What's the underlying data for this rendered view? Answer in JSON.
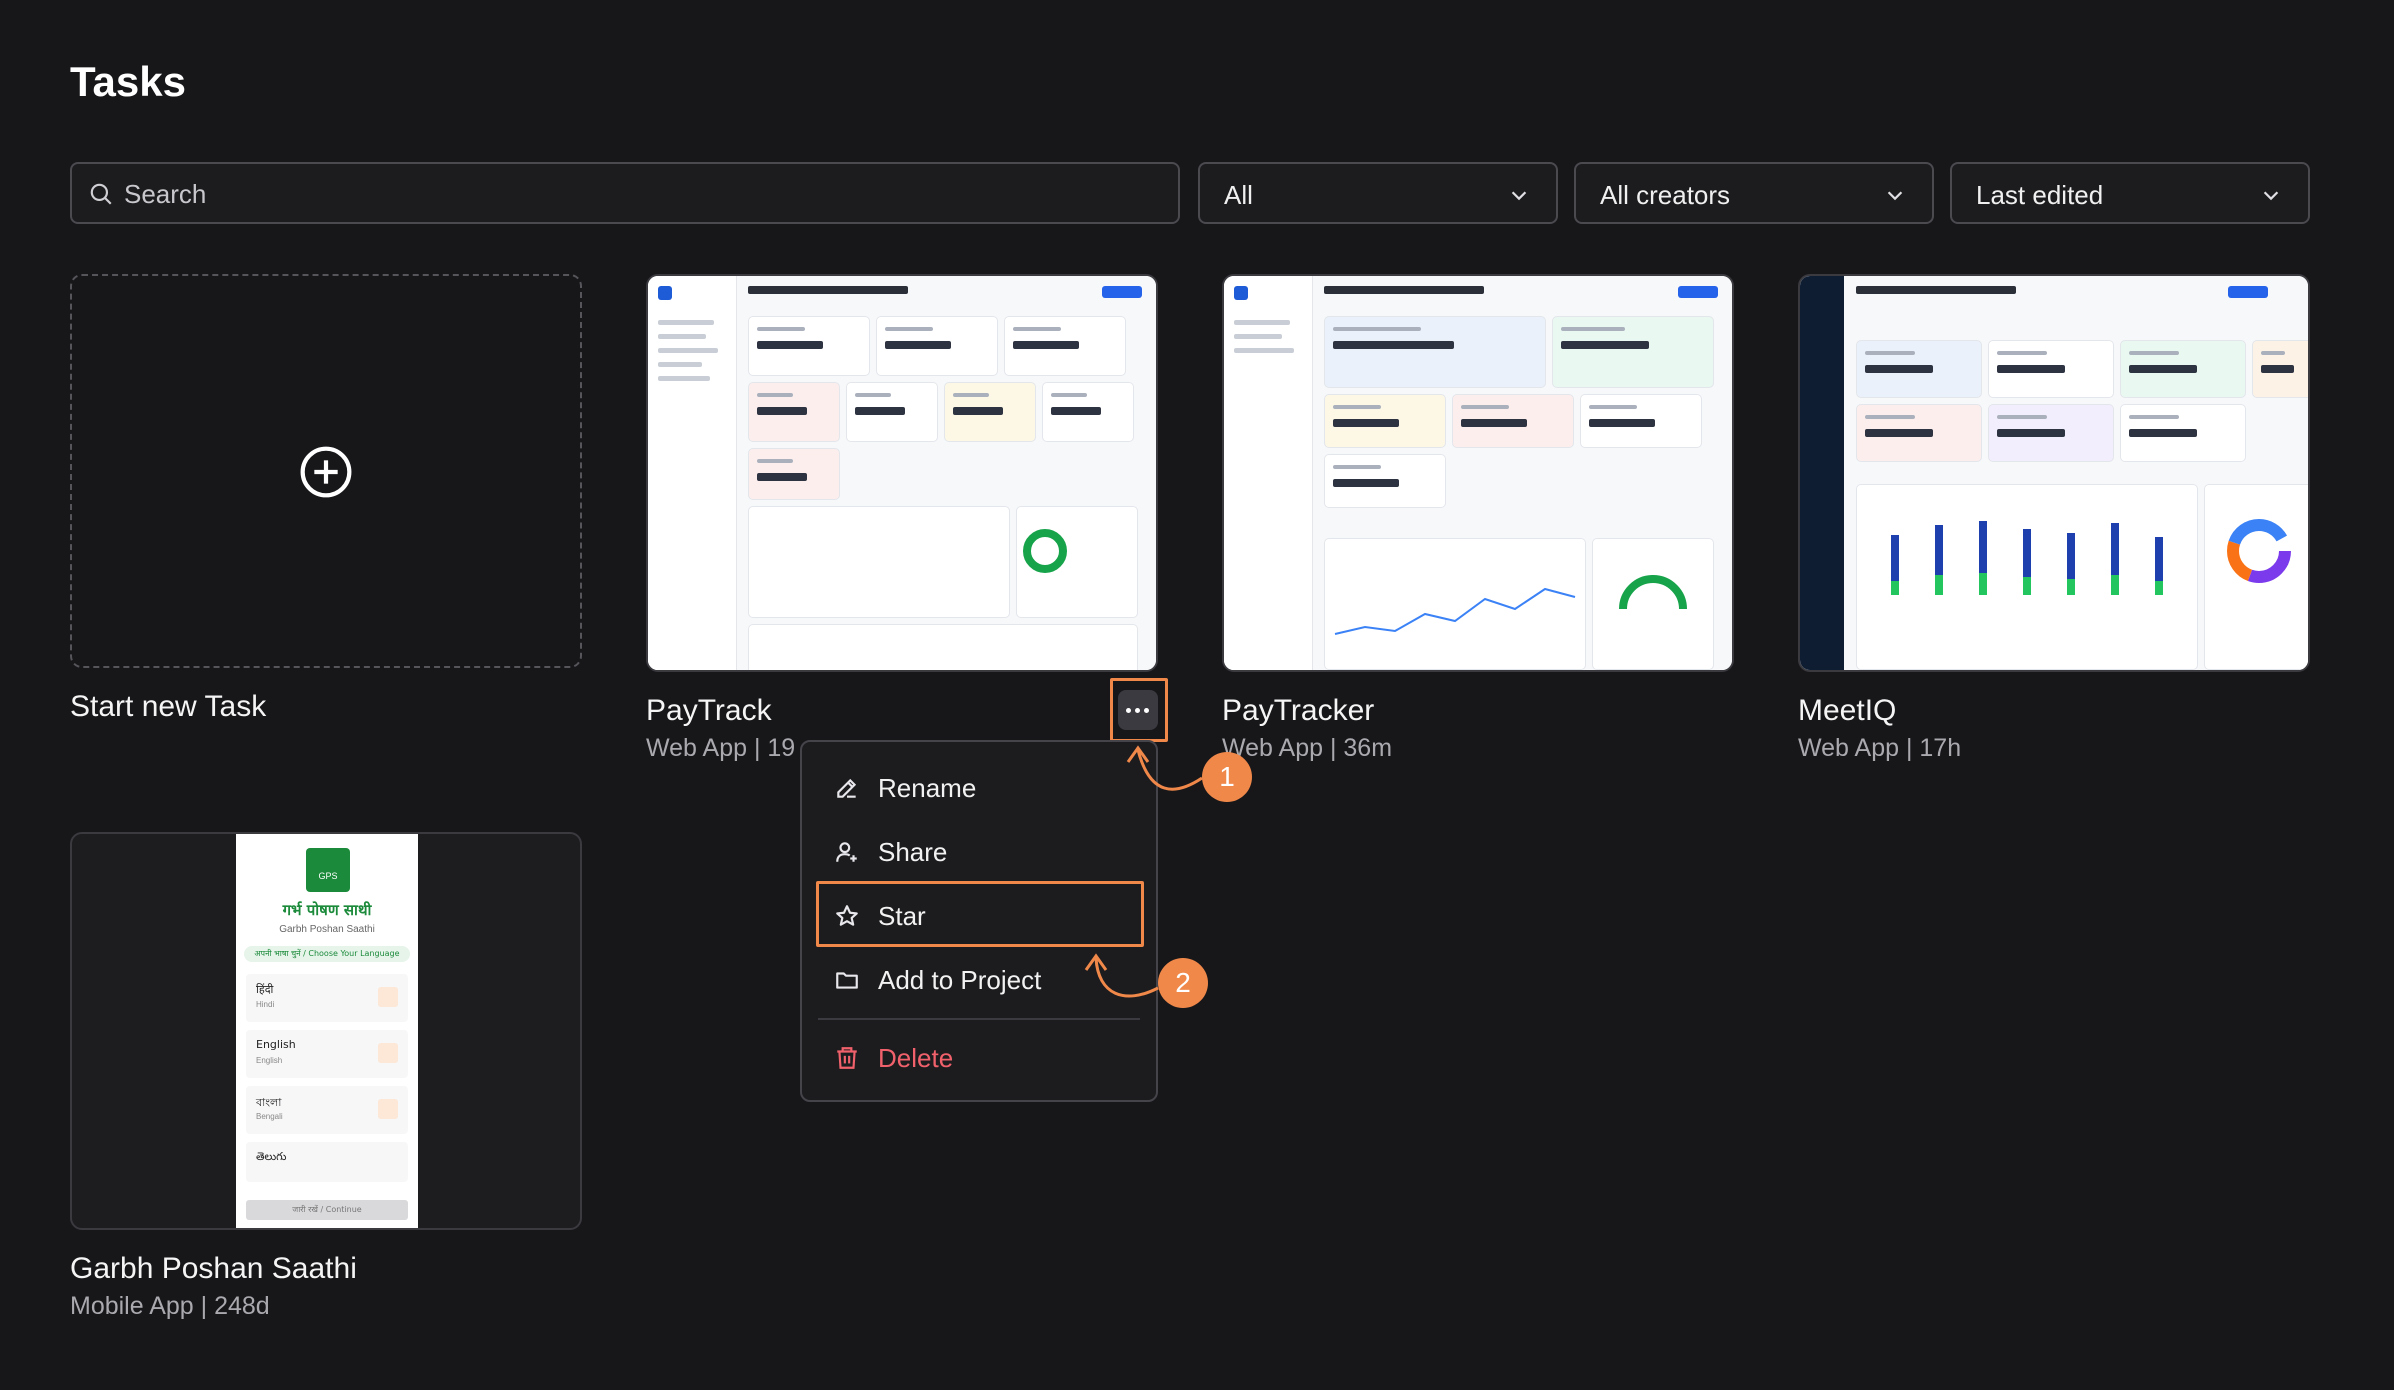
{
  "page": {
    "title": "Tasks"
  },
  "filters": {
    "search_placeholder": "Search",
    "type_filter": "All",
    "creator_filter": "All creators",
    "sort": "Last edited"
  },
  "new_task": {
    "label": "Start new Task"
  },
  "cards": [
    {
      "title": "PayTrack",
      "meta": "Web App | 19"
    },
    {
      "title": "PayTracker",
      "meta": "Web App | 36m"
    },
    {
      "title": "MeetIQ",
      "meta": "Web App | 17h"
    },
    {
      "title": "Garbh Poshan Saathi",
      "meta": "Mobile App | 248d"
    }
  ],
  "context_menu": {
    "items": [
      {
        "label": "Rename",
        "icon": "pencil-icon"
      },
      {
        "label": "Share",
        "icon": "user-plus-icon"
      },
      {
        "label": "Star",
        "icon": "star-icon"
      },
      {
        "label": "Add to Project",
        "icon": "folder-icon"
      },
      {
        "label": "Delete",
        "icon": "trash-icon"
      }
    ]
  },
  "annotations": {
    "step1": "1",
    "step2": "2"
  },
  "gps_preview": {
    "logo": "GPS",
    "title": "गर्भ पोषण साथी",
    "subtitle": "Garbh Poshan Saathi",
    "choose": "अपनी भाषा चुनें / Choose Your Language",
    "options": [
      {
        "name": "हिंदी",
        "sub": "Hindi"
      },
      {
        "name": "English",
        "sub": "English"
      },
      {
        "name": "বাংলা",
        "sub": "Bengali"
      },
      {
        "name": "తెలుగు",
        "sub": ""
      }
    ],
    "continue": "जारी रखें / Continue"
  },
  "colors": {
    "accent": "#f0884a",
    "danger": "#f0616b",
    "background": "#17171a"
  }
}
